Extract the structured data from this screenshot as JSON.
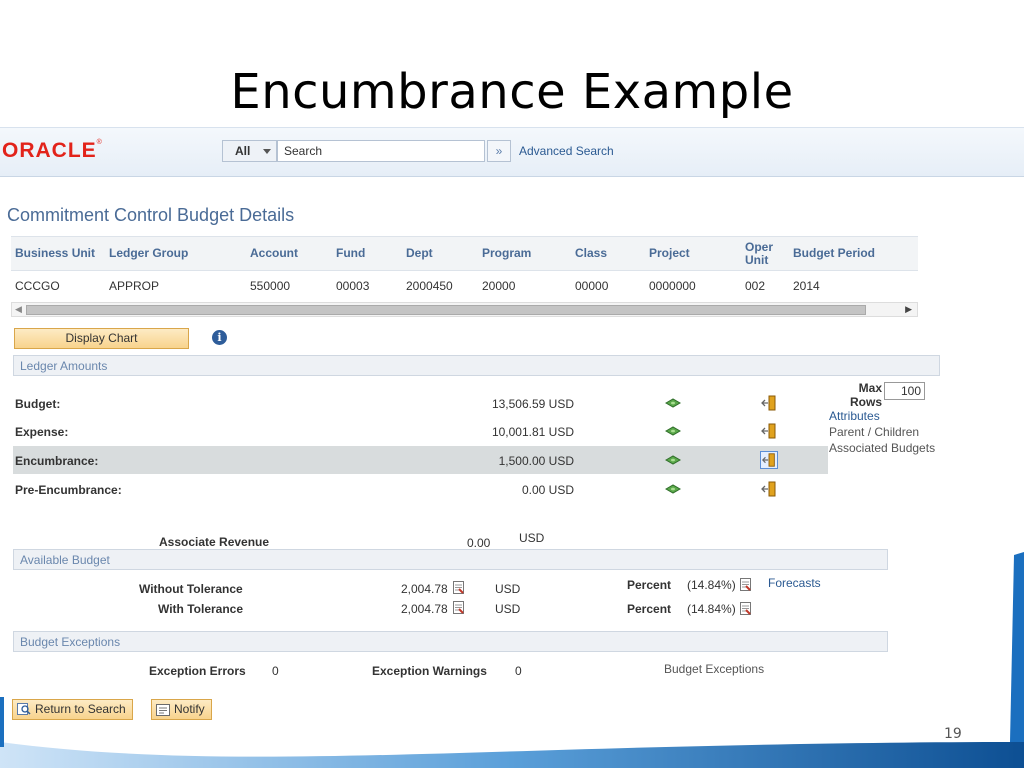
{
  "slide": {
    "title": "Encumbrance Example",
    "number": "19"
  },
  "header": {
    "logo": "ORACLE",
    "search_scope": "All",
    "search_value": "Search",
    "go_glyph": "»",
    "advanced_search": "Advanced Search"
  },
  "page_title": "Commitment Control Budget Details",
  "grid": {
    "columns": [
      "Business Unit",
      "Ledger Group",
      "Account",
      "Fund",
      "Dept",
      "Program",
      "Class",
      "Project",
      "Oper Unit",
      "Budget Period"
    ],
    "row": [
      "CCCGO",
      "APPROP",
      "550000",
      "00003",
      "2000450",
      "20000",
      "00000",
      "0000000",
      "002",
      "2014"
    ]
  },
  "display_chart_label": "Display Chart",
  "ledger_amounts": {
    "section_title": "Ledger Amounts",
    "rows": [
      {
        "label": "Budget:",
        "amount": "13,506.59 USD"
      },
      {
        "label": "Expense:",
        "amount": "10,001.81 USD"
      },
      {
        "label": "Encumbrance:",
        "amount": "1,500.00 USD"
      },
      {
        "label": "Pre-Encumbrance:",
        "amount": "0.00 USD"
      }
    ],
    "max_rows_label": "Max Rows",
    "max_rows_value": "100",
    "links": [
      "Attributes",
      "Parent / Children",
      "Associated Budgets"
    ]
  },
  "associate_revenue": {
    "label": "Associate Revenue",
    "amount": "0.00",
    "currency": "USD"
  },
  "available_budget": {
    "section_title": "Available Budget",
    "rows": [
      {
        "label": "Without Tolerance",
        "amount": "2,004.78",
        "currency": "USD",
        "percent_label": "Percent",
        "percent": "(14.84%)"
      },
      {
        "label": "With Tolerance",
        "amount": "2,004.78",
        "currency": "USD",
        "percent_label": "Percent",
        "percent": "(14.84%)"
      }
    ],
    "forecasts_link": "Forecasts"
  },
  "budget_exceptions": {
    "section_title": "Budget Exceptions",
    "errors_label": "Exception Errors",
    "errors_value": "0",
    "warnings_label": "Exception Warnings",
    "warnings_value": "0",
    "link": "Budget Exceptions"
  },
  "buttons": {
    "return_to_search": "Return to Search",
    "notify": "Notify"
  },
  "icons": {
    "info": "info-icon",
    "ledger_inquiry": "money-icon",
    "drill_down": "door-arrow-icon",
    "report": "report-icon",
    "search": "magnifier-icon",
    "notify": "notify-icon"
  },
  "colors": {
    "oracle_red": "#e2231a",
    "link_blue": "#2b5a92",
    "button_gold": "#f8d38d",
    "slide_accent": "#1b6fbf"
  }
}
